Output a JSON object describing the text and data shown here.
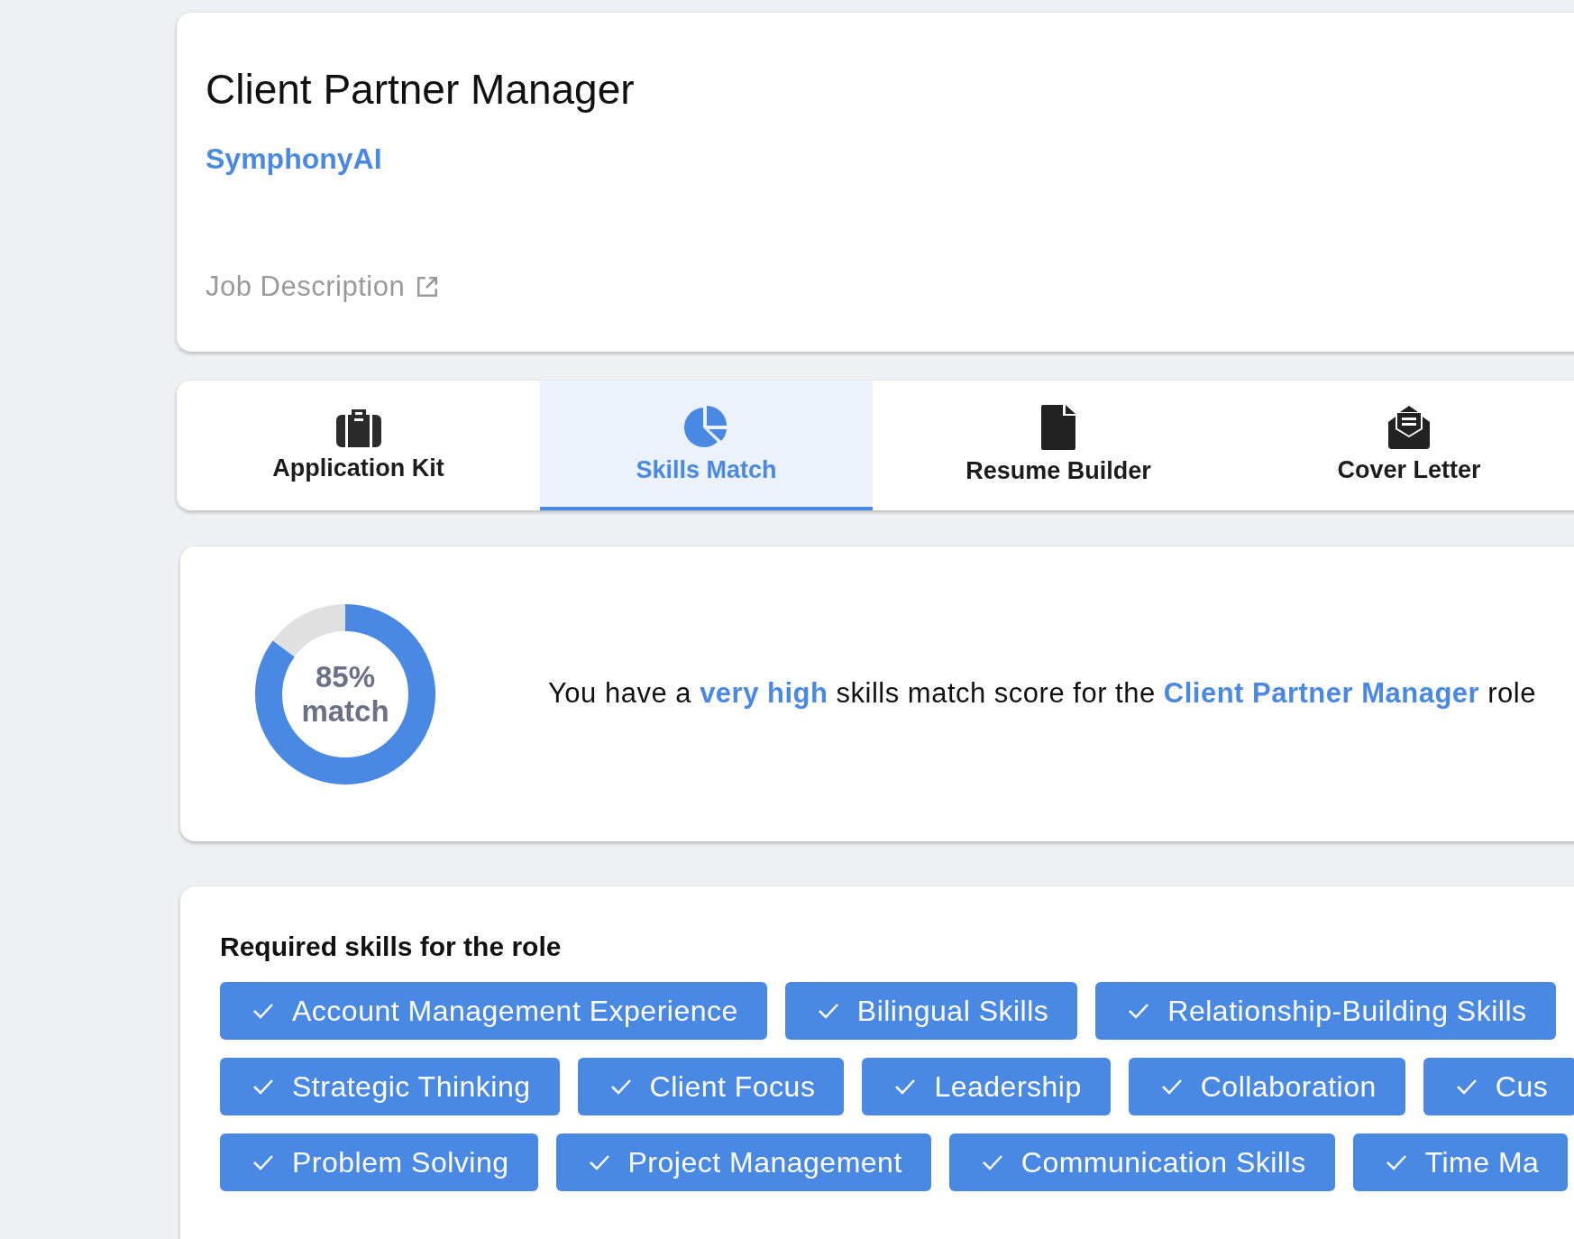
{
  "job": {
    "title": "Client Partner Manager",
    "company": "SymphonyAI",
    "description_link": "Job Description"
  },
  "tabs": [
    {
      "label": "Application Kit",
      "selected": false
    },
    {
      "label": "Skills Match",
      "selected": true
    },
    {
      "label": "Resume Builder",
      "selected": false
    },
    {
      "label": "Cover Letter",
      "selected": false
    }
  ],
  "score": {
    "level": 0.85,
    "value": "85%",
    "unit": "match",
    "sentence": "You have a **very high** skills match score for the **Client Partner Manager** role"
  },
  "skills": {
    "heading": "Required skills for the role",
    "chips": [
      "Account Management Experience",
      "Bilingual Skills",
      "Relationship-Building Skills",
      "Strategic Thinking",
      "Client Focus",
      "Leadership",
      "Collaboration",
      "Cus",
      "Problem Solving",
      "Project Management",
      "Communication Skills",
      "Time Ma"
    ]
  }
}
